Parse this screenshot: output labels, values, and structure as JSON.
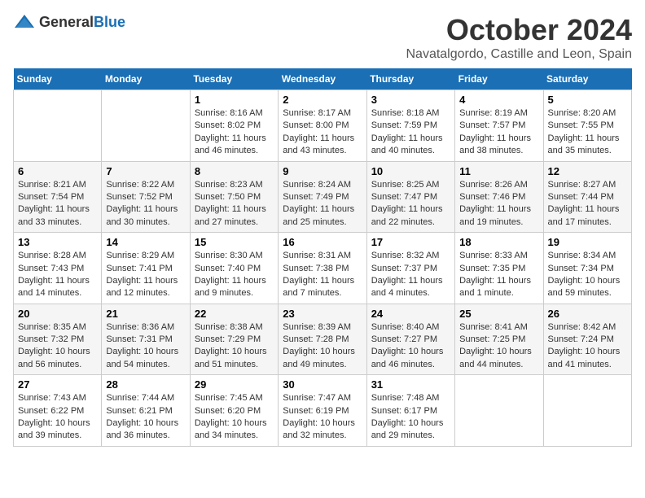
{
  "header": {
    "logo_general": "General",
    "logo_blue": "Blue",
    "month": "October 2024",
    "location": "Navatalgordo, Castille and Leon, Spain"
  },
  "weekdays": [
    "Sunday",
    "Monday",
    "Tuesday",
    "Wednesday",
    "Thursday",
    "Friday",
    "Saturday"
  ],
  "weeks": [
    [
      {
        "day": "",
        "info": ""
      },
      {
        "day": "",
        "info": ""
      },
      {
        "day": "1",
        "info": "Sunrise: 8:16 AM\nSunset: 8:02 PM\nDaylight: 11 hours and 46 minutes."
      },
      {
        "day": "2",
        "info": "Sunrise: 8:17 AM\nSunset: 8:00 PM\nDaylight: 11 hours and 43 minutes."
      },
      {
        "day": "3",
        "info": "Sunrise: 8:18 AM\nSunset: 7:59 PM\nDaylight: 11 hours and 40 minutes."
      },
      {
        "day": "4",
        "info": "Sunrise: 8:19 AM\nSunset: 7:57 PM\nDaylight: 11 hours and 38 minutes."
      },
      {
        "day": "5",
        "info": "Sunrise: 8:20 AM\nSunset: 7:55 PM\nDaylight: 11 hours and 35 minutes."
      }
    ],
    [
      {
        "day": "6",
        "info": "Sunrise: 8:21 AM\nSunset: 7:54 PM\nDaylight: 11 hours and 33 minutes."
      },
      {
        "day": "7",
        "info": "Sunrise: 8:22 AM\nSunset: 7:52 PM\nDaylight: 11 hours and 30 minutes."
      },
      {
        "day": "8",
        "info": "Sunrise: 8:23 AM\nSunset: 7:50 PM\nDaylight: 11 hours and 27 minutes."
      },
      {
        "day": "9",
        "info": "Sunrise: 8:24 AM\nSunset: 7:49 PM\nDaylight: 11 hours and 25 minutes."
      },
      {
        "day": "10",
        "info": "Sunrise: 8:25 AM\nSunset: 7:47 PM\nDaylight: 11 hours and 22 minutes."
      },
      {
        "day": "11",
        "info": "Sunrise: 8:26 AM\nSunset: 7:46 PM\nDaylight: 11 hours and 19 minutes."
      },
      {
        "day": "12",
        "info": "Sunrise: 8:27 AM\nSunset: 7:44 PM\nDaylight: 11 hours and 17 minutes."
      }
    ],
    [
      {
        "day": "13",
        "info": "Sunrise: 8:28 AM\nSunset: 7:43 PM\nDaylight: 11 hours and 14 minutes."
      },
      {
        "day": "14",
        "info": "Sunrise: 8:29 AM\nSunset: 7:41 PM\nDaylight: 11 hours and 12 minutes."
      },
      {
        "day": "15",
        "info": "Sunrise: 8:30 AM\nSunset: 7:40 PM\nDaylight: 11 hours and 9 minutes."
      },
      {
        "day": "16",
        "info": "Sunrise: 8:31 AM\nSunset: 7:38 PM\nDaylight: 11 hours and 7 minutes."
      },
      {
        "day": "17",
        "info": "Sunrise: 8:32 AM\nSunset: 7:37 PM\nDaylight: 11 hours and 4 minutes."
      },
      {
        "day": "18",
        "info": "Sunrise: 8:33 AM\nSunset: 7:35 PM\nDaylight: 11 hours and 1 minute."
      },
      {
        "day": "19",
        "info": "Sunrise: 8:34 AM\nSunset: 7:34 PM\nDaylight: 10 hours and 59 minutes."
      }
    ],
    [
      {
        "day": "20",
        "info": "Sunrise: 8:35 AM\nSunset: 7:32 PM\nDaylight: 10 hours and 56 minutes."
      },
      {
        "day": "21",
        "info": "Sunrise: 8:36 AM\nSunset: 7:31 PM\nDaylight: 10 hours and 54 minutes."
      },
      {
        "day": "22",
        "info": "Sunrise: 8:38 AM\nSunset: 7:29 PM\nDaylight: 10 hours and 51 minutes."
      },
      {
        "day": "23",
        "info": "Sunrise: 8:39 AM\nSunset: 7:28 PM\nDaylight: 10 hours and 49 minutes."
      },
      {
        "day": "24",
        "info": "Sunrise: 8:40 AM\nSunset: 7:27 PM\nDaylight: 10 hours and 46 minutes."
      },
      {
        "day": "25",
        "info": "Sunrise: 8:41 AM\nSunset: 7:25 PM\nDaylight: 10 hours and 44 minutes."
      },
      {
        "day": "26",
        "info": "Sunrise: 8:42 AM\nSunset: 7:24 PM\nDaylight: 10 hours and 41 minutes."
      }
    ],
    [
      {
        "day": "27",
        "info": "Sunrise: 7:43 AM\nSunset: 6:22 PM\nDaylight: 10 hours and 39 minutes."
      },
      {
        "day": "28",
        "info": "Sunrise: 7:44 AM\nSunset: 6:21 PM\nDaylight: 10 hours and 36 minutes."
      },
      {
        "day": "29",
        "info": "Sunrise: 7:45 AM\nSunset: 6:20 PM\nDaylight: 10 hours and 34 minutes."
      },
      {
        "day": "30",
        "info": "Sunrise: 7:47 AM\nSunset: 6:19 PM\nDaylight: 10 hours and 32 minutes."
      },
      {
        "day": "31",
        "info": "Sunrise: 7:48 AM\nSunset: 6:17 PM\nDaylight: 10 hours and 29 minutes."
      },
      {
        "day": "",
        "info": ""
      },
      {
        "day": "",
        "info": ""
      }
    ]
  ]
}
